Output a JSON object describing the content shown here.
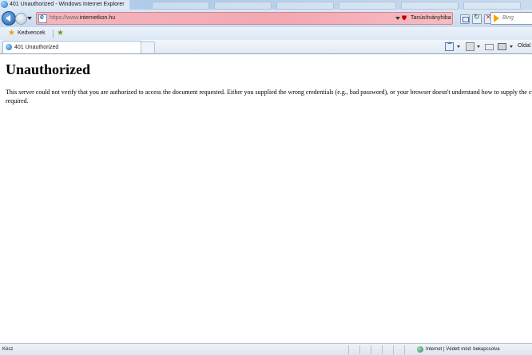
{
  "window": {
    "title": "401 Unauthorized - Windows Internet Explorer"
  },
  "address_bar": {
    "url_prefix": "https://www.",
    "url_domain": "internetkon.hu",
    "certificate_error": "Tanúsítványhiba",
    "search_placeholder": "Bing"
  },
  "favorites_bar": {
    "favorites_label": "Kedvencek"
  },
  "tabs": [
    {
      "label": "401 Unauthorized"
    }
  ],
  "command_bar": {
    "page_menu_label": "Oldal"
  },
  "page": {
    "heading": "Unauthorized",
    "body": "This server could not verify that you are authorized to access the document requested. Either you supplied the wrong credentials (e.g., bad password), or your browser doesn't understand how to supply the credentials required."
  },
  "status_bar": {
    "status": "Kész",
    "zone": "Internet | Védett mód: bekapcsolva"
  },
  "colors": {
    "address_error_bg": "#f3a7b1",
    "chrome_blue": "#c8daee"
  }
}
